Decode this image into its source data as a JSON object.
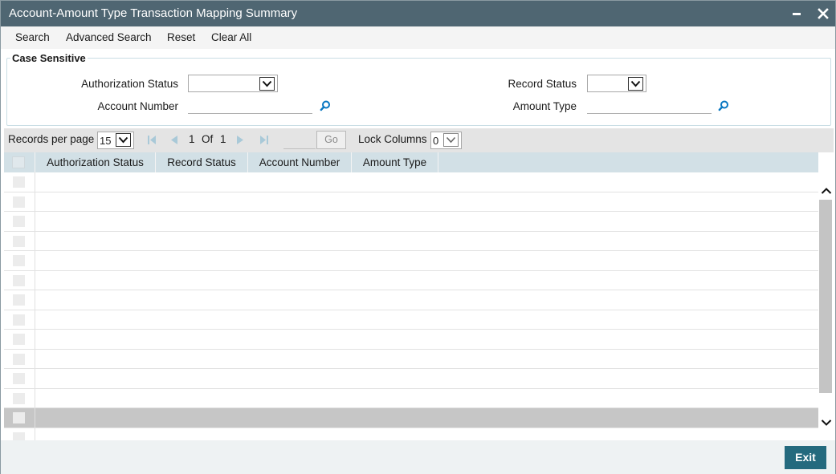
{
  "window": {
    "title": "Account-Amount Type Transaction Mapping Summary"
  },
  "toolbar": {
    "search": "Search",
    "advanced_search": "Advanced Search",
    "reset": "Reset",
    "clear_all": "Clear All"
  },
  "criteria": {
    "legend": "Case Sensitive",
    "authorization_status": {
      "label": "Authorization Status",
      "value": ""
    },
    "record_status": {
      "label": "Record Status",
      "value": ""
    },
    "account_number": {
      "label": "Account Number",
      "value": ""
    },
    "amount_type": {
      "label": "Amount Type",
      "value": ""
    }
  },
  "pager": {
    "records_per_page_label": "Records per page",
    "records_per_page_value": "15",
    "current_page": "1",
    "of_label": "Of",
    "total_pages": "1",
    "go_label": "Go",
    "lock_columns_label": "Lock Columns",
    "lock_columns_value": "0"
  },
  "grid": {
    "columns": [
      "Authorization Status",
      "Record Status",
      "Account Number",
      "Amount Type"
    ]
  },
  "footer": {
    "exit": "Exit"
  },
  "colors": {
    "titlebar": "#4f6672",
    "grid_header": "#d2e0e6",
    "exit_button": "#246a7e",
    "lookup_icon": "#0a78c2"
  }
}
